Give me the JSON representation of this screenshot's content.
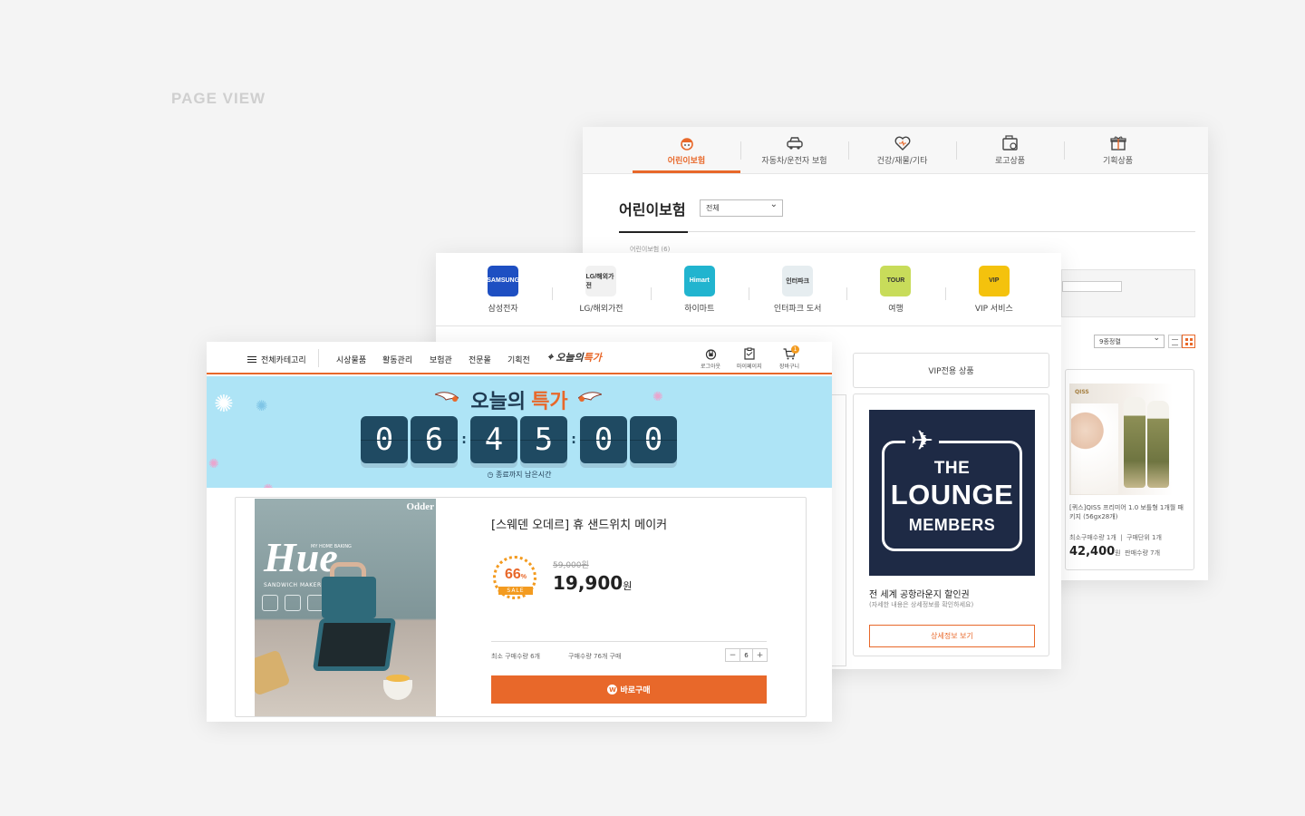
{
  "page_label": "PAGE VIEW",
  "colors": {
    "accent": "#e8682a",
    "banner_bg": "#aee4f6",
    "digit_bg": "#1f4a62",
    "lounge_bg": "#1e2a45"
  },
  "back_panel": {
    "tabs": [
      {
        "label": "어린이보험",
        "icon": "child-icon",
        "active": true
      },
      {
        "label": "자동차/운전자 보험",
        "icon": "car-icon",
        "active": false
      },
      {
        "label": "건강/재물/기타",
        "icon": "heart-icon",
        "active": false
      },
      {
        "label": "로고상품",
        "icon": "logo-goods-icon",
        "active": false
      },
      {
        "label": "기획상품",
        "icon": "gift-icon",
        "active": false
      }
    ],
    "heading": "어린이보험",
    "category_select": "전체",
    "subline": "어린이보험 (6)",
    "sort_select": "9종정렬",
    "product": {
      "brand": "QISS",
      "name": "[퀴스]QISS 프리미어 1.0 보틀형 1개월 패키지 (56gx28개)",
      "min_qty_label": "최소구매수량",
      "min_qty": "1개",
      "unit_label": "구매단위",
      "unit": "1개",
      "price": "42,400",
      "price_unit": "원",
      "stock_note": "판매수량 7개"
    }
  },
  "middle_panel": {
    "brands": [
      {
        "label": "삼성전자",
        "logo_text": "SAMSUNG",
        "color": "#1e4fc2"
      },
      {
        "label": "LG/해외가전",
        "logo_text": "LG/해외가전",
        "color": "#f1f1f1"
      },
      {
        "label": "하이마트",
        "logo_text": "Himart",
        "color": "#21b4cf"
      },
      {
        "label": "인터파크 도서",
        "logo_text": "인터파크",
        "color": "#e6edf0"
      },
      {
        "label": "여행",
        "logo_text": "TOUR",
        "color": "#c8dc5a"
      },
      {
        "label": "VIP 서비스",
        "logo_text": "VIP",
        "color": "#f4c20d"
      }
    ],
    "vip_tab": "VIP전용 상품",
    "lounge": {
      "line1": "THE",
      "line2": "LOUNGE",
      "line3": "MEMBERS"
    },
    "vip_title": "전 세계 공항라운지 할인권",
    "vip_sub": "(자세한 내용은 상세정보를 확인하세요)",
    "vip_button": "상세정보 보기"
  },
  "front_panel": {
    "all_category": "전체카테고리",
    "menu": [
      "시상물품",
      "활동관리",
      "보험관",
      "전문몰",
      "기획전"
    ],
    "today_special": {
      "prefix": "오늘의",
      "suffix": "특가"
    },
    "util": [
      {
        "label": "로그아웃",
        "icon": "logout-icon"
      },
      {
        "label": "마이페이지",
        "icon": "mypage-icon"
      },
      {
        "label": "장바구니",
        "icon": "cart-icon",
        "badge": "1"
      }
    ],
    "banner": {
      "title_prefix": "오늘의",
      "title_suffix": "특가",
      "digits": [
        "0",
        "6",
        "4",
        "5",
        "0",
        "0"
      ],
      "remaining_label": "종료까지 남은시간"
    },
    "product": {
      "photo_brand": "Odder",
      "photo_title": "Hue",
      "photo_small": "MY HOME BAKING",
      "photo_subtitle": "SANDWICH MAKER",
      "name": "[스웨덴 오데르] 휴 샌드위치 메이커",
      "discount": "66",
      "discount_unit": "%",
      "sale_label": "SALE",
      "old_price": "59,000원",
      "price": "19,900",
      "price_unit": "원",
      "min_qty": "최소 구매수량 6개",
      "buy_qty": "구매수량 76개 구매",
      "quantity": "6",
      "buy_button": "바로구매",
      "buy_icon_letter": "W"
    }
  }
}
